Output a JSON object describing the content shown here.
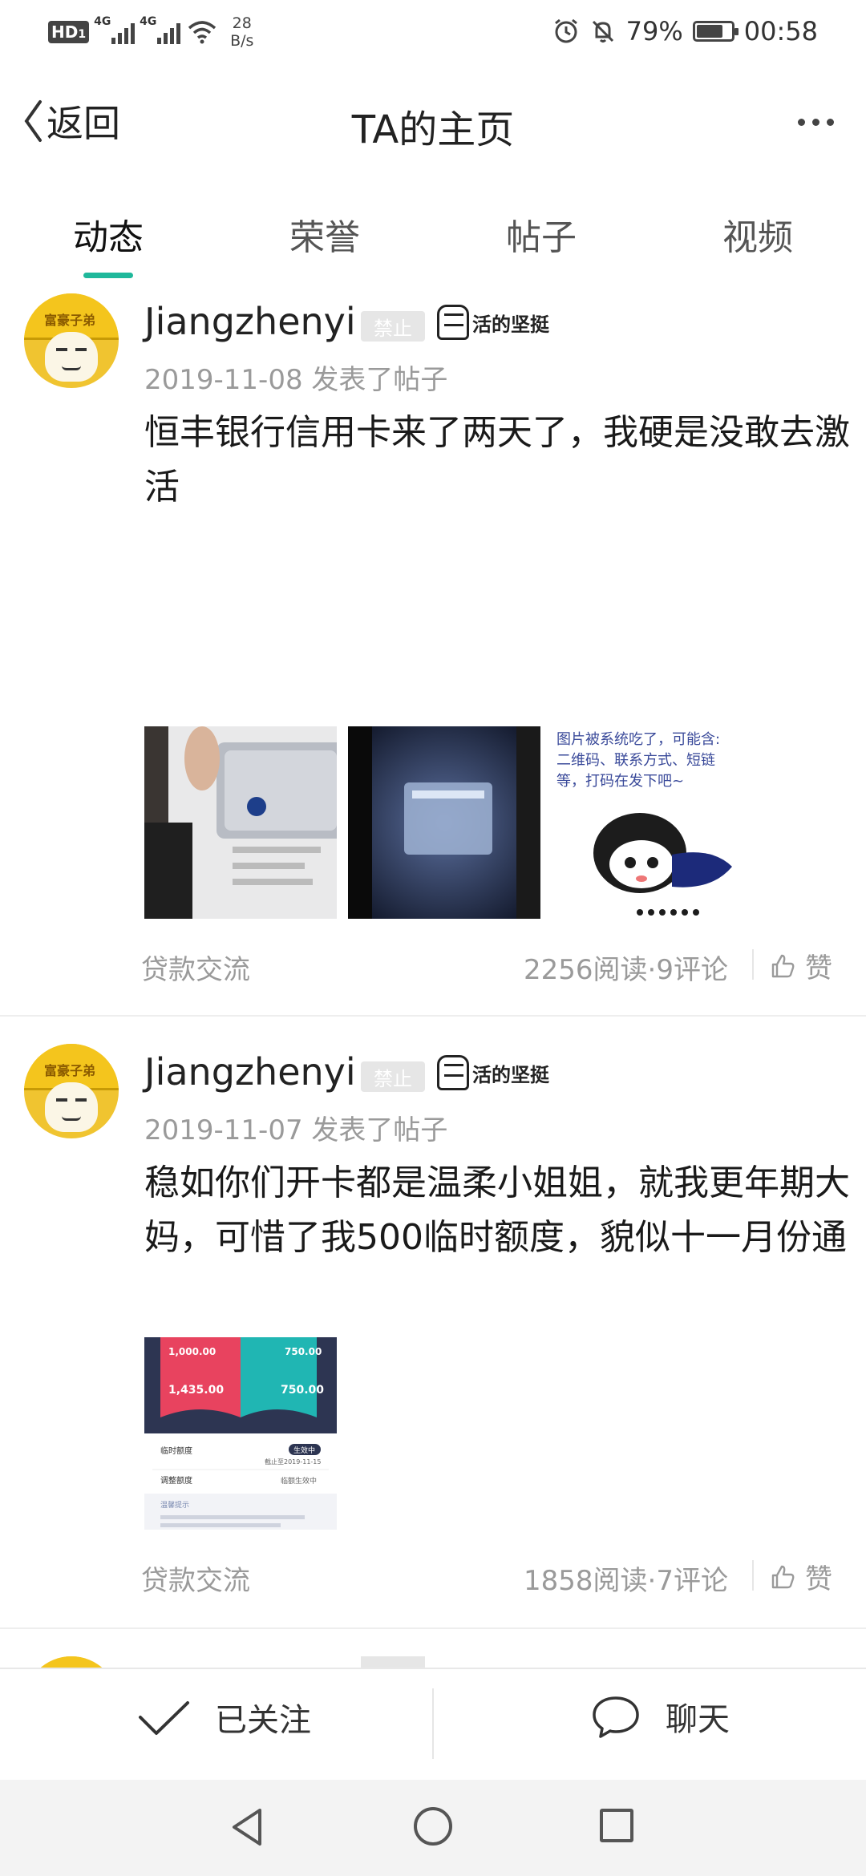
{
  "status_bar": {
    "hd": "HD",
    "sim_num": "1",
    "net1": "4G",
    "net2": "4G",
    "speed_value": "28",
    "speed_unit": "B/s",
    "battery_percent": "79%",
    "battery_level": 0.79,
    "time": "00:58"
  },
  "header": {
    "back_label": "返回",
    "title": "TA的主页"
  },
  "tabs": [
    {
      "label": "动态",
      "active": true
    },
    {
      "label": "荣誉",
      "active": false
    },
    {
      "label": "帖子",
      "active": false
    },
    {
      "label": "视频",
      "active": false
    }
  ],
  "posts": [
    {
      "username": "Jiangzhenyi",
      "ban_badge": "禁止",
      "medal_text": "活的坚挺",
      "avatar_caption": "富豪子弟",
      "date": "2019-11-08",
      "action": "发表了帖子",
      "text": "恒丰银行信用卡来了两天了，我硬是没敢去激活",
      "image_notice": "图片被系统吃了，可能含:\n二维码、联系方式、短链\n等，打码在发下吧~",
      "category": "贷款交流",
      "stats": "2256阅读·9评论",
      "like_label": "赞"
    },
    {
      "username": "Jiangzhenyi",
      "ban_badge": "禁止",
      "medal_text": "活的坚挺",
      "avatar_caption": "富豪子弟",
      "date": "2019-11-07",
      "action": "发表了帖子",
      "text": "稳如你们开卡都是温柔小姐姐，就我更年期大妈，可惜了我500临时额度，貌似十一月份通",
      "card_image": {
        "amount_left_top": "1,000.00",
        "amount_left_bottom": "1,435.00",
        "amount_right_top": "750.00",
        "amount_right_bottom": "750.00",
        "row1_label": "临时额度",
        "row1_status": "生效中",
        "row1_date": "截止至2019-11-15",
        "row2_label": "调整额度",
        "row2_value": "临额生效中",
        "tip": "温馨提示"
      },
      "category": "贷款交流",
      "stats": "1858阅读·7评论",
      "like_label": "赞"
    }
  ],
  "action_bar": {
    "follow_label": "已关注",
    "chat_label": "聊天"
  }
}
